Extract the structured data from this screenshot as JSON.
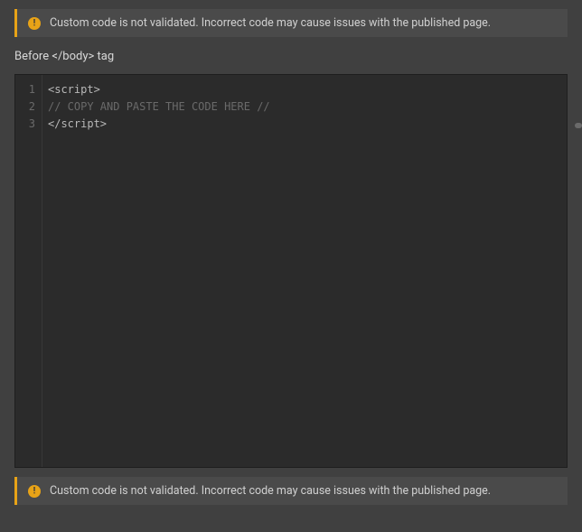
{
  "alerts": {
    "top": {
      "text": "Custom code is not validated. Incorrect code may cause issues with the published page."
    },
    "bottom": {
      "text": "Custom code is not validated. Incorrect code may cause issues with the published page."
    }
  },
  "section": {
    "label": "Before </body> tag"
  },
  "editor": {
    "lines": [
      {
        "number": "1",
        "type": "tag",
        "content": "<script>"
      },
      {
        "number": "2",
        "type": "comment",
        "content": "// COPY AND PASTE THE CODE HERE //"
      },
      {
        "number": "3",
        "type": "tag",
        "content": "</script>"
      }
    ]
  }
}
